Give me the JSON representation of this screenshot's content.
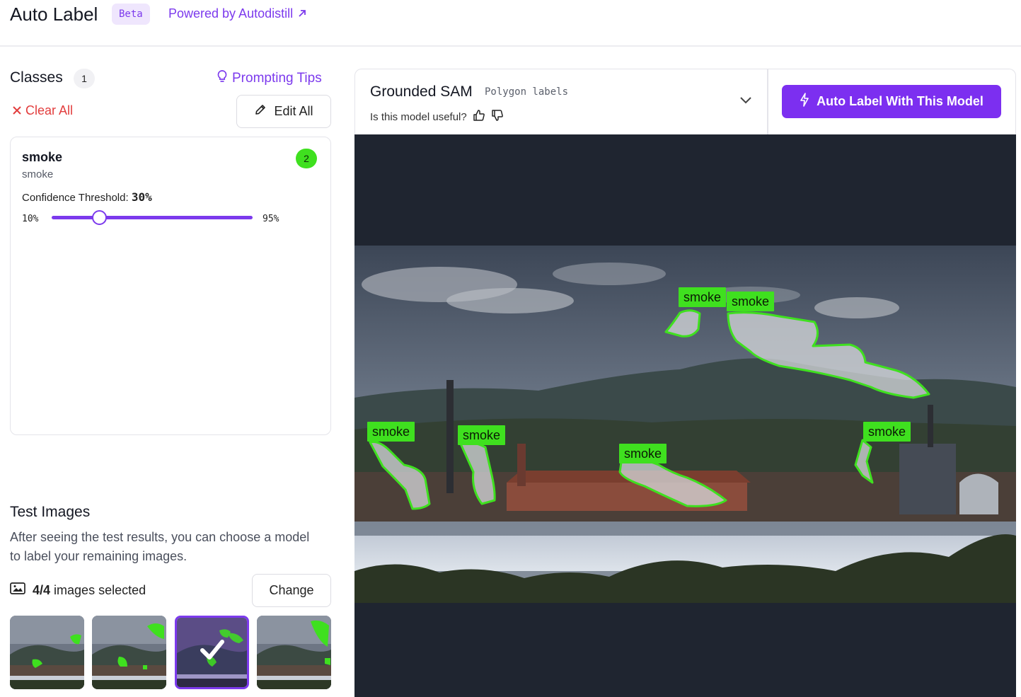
{
  "header": {
    "title": "Auto Label",
    "beta": "Beta",
    "powered_by": "Powered by Autodistill",
    "external_icon": "external-link-icon"
  },
  "classes": {
    "title": "Classes",
    "count": "1",
    "prompting_tips": "Prompting Tips",
    "clear_all": "Clear All",
    "edit_all": "Edit All",
    "items": [
      {
        "name": "smoke",
        "prompt": "smoke",
        "detections": "2",
        "confidence_label": "Confidence Threshold:",
        "confidence_value": "30%",
        "confidence_fraction": 0.3,
        "slider_min": "10%",
        "slider_max": "95%"
      }
    ]
  },
  "test_images": {
    "title": "Test Images",
    "description": "After seeing the test results, you can choose a model to label your remaining images.",
    "selected_count": "4/4",
    "selected_text": "images selected",
    "change": "Change",
    "thumbnails": [
      {
        "selected": false
      },
      {
        "selected": false
      },
      {
        "selected": true
      },
      {
        "selected": false
      }
    ]
  },
  "model": {
    "name": "Grounded SAM",
    "tag": "Polygon labels",
    "useful_question": "Is this model useful?",
    "auto_label_button": "Auto Label With This Model"
  },
  "detections": {
    "color": "#3fe01f",
    "labels": [
      "smoke",
      "smoke",
      "smoke",
      "smoke",
      "smoke",
      "smoke"
    ]
  },
  "colors": {
    "accent": "#7c3aed",
    "danger": "#e23d3d",
    "detection": "#3fe01f"
  }
}
